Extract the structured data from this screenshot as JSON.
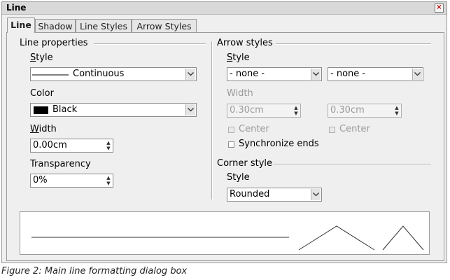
{
  "window": {
    "title": "Line"
  },
  "tabs": [
    {
      "label": "Line",
      "active": true
    },
    {
      "label": "Shadow",
      "active": false
    },
    {
      "label": "Line Styles",
      "active": false
    },
    {
      "label": "Arrow Styles",
      "active": false
    }
  ],
  "line_properties": {
    "heading": "Line properties",
    "style_label": "Style",
    "style_value": "Continuous",
    "color_label": "Color",
    "color_value": "Black",
    "color_swatch": "#000000",
    "width_label": "Width",
    "width_value": "0.00cm",
    "transparency_label": "Transparency",
    "transparency_value": "0%"
  },
  "arrow_styles": {
    "heading": "Arrow styles",
    "style_label": "Style",
    "start_style": "- none -",
    "end_style": "- none -",
    "width_label": "Width",
    "start_width": "0.30cm",
    "end_width": "0.30cm",
    "center_label": "Center",
    "synchronize_label": "Synchronize ends"
  },
  "corner_style": {
    "heading": "Corner style",
    "style_label": "Style",
    "style_value": "Rounded"
  },
  "caption": "Figure 2: Main line formatting dialog box"
}
